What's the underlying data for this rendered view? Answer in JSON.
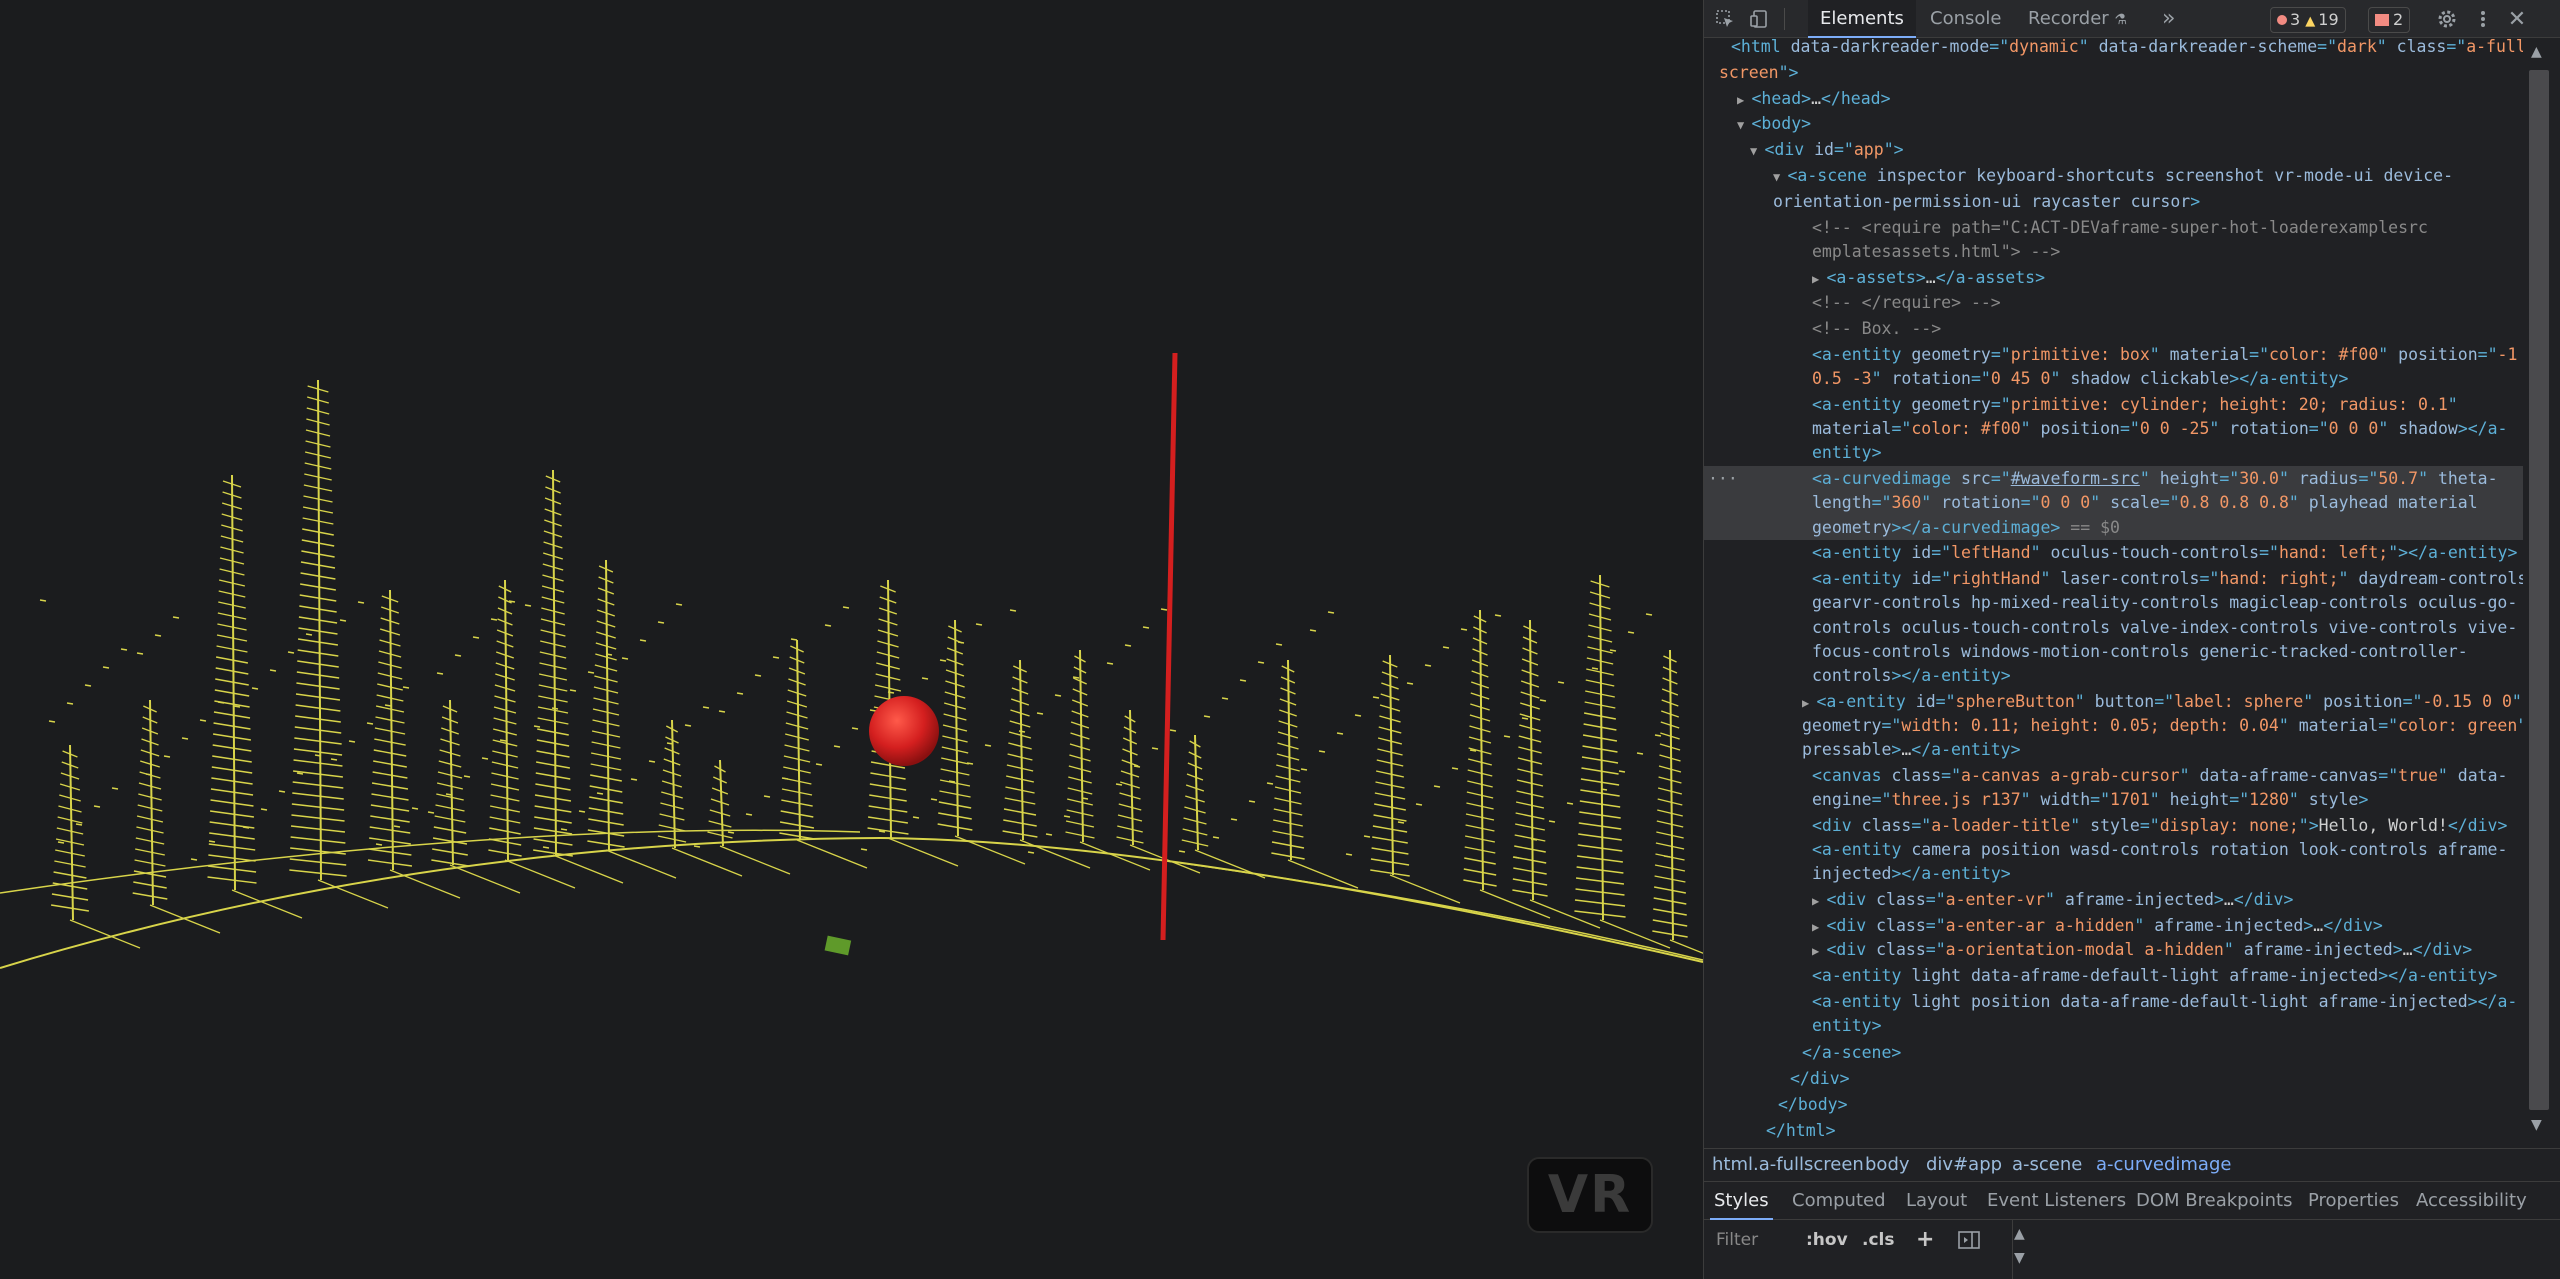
{
  "devtools": {
    "tabs": {
      "elements": "Elements",
      "console": "Console",
      "recorder": "Recorder",
      "more": "»"
    },
    "counters": {
      "errors": "3",
      "warnings": "19",
      "issues": "2"
    },
    "tree": [
      {
        "parts": [
          [
            "tag",
            "<html "
          ],
          [
            "an",
            "data-darkreader-mode"
          ],
          [
            "tag",
            "=\""
          ],
          [
            "av",
            "dynamic"
          ],
          [
            "tag",
            "\" "
          ],
          [
            "an",
            "data-darkreader-scheme"
          ],
          [
            "tag",
            "=\""
          ],
          [
            "av",
            "dark"
          ],
          [
            "tag",
            "\" "
          ],
          [
            "an",
            "class"
          ],
          [
            "tag",
            "=\""
          ],
          [
            "av",
            "a-full"
          ]
        ]
      },
      {
        "parts": [
          [
            "av",
            "screen"
          ],
          [
            "tag",
            "\">"
          ]
        ]
      },
      {
        "parts": [
          [
            "tag",
            "<head>"
          ],
          [
            "tx",
            "…"
          ],
          [
            "tag",
            "</head>"
          ]
        ]
      },
      {
        "parts": [
          [
            "tag",
            "<body>"
          ]
        ]
      },
      {
        "parts": [
          [
            "tag",
            "<div "
          ],
          [
            "an",
            "id"
          ],
          [
            "tag",
            "=\""
          ],
          [
            "av",
            "app"
          ],
          [
            "tag",
            "\">"
          ]
        ]
      },
      {
        "parts": [
          [
            "tag",
            "<a-scene "
          ],
          [
            "an",
            "inspector keyboard-shortcuts screenshot vr-mode-ui device-"
          ]
        ]
      },
      {
        "parts": [
          [
            "an",
            "orientation-permission-ui raycaster cursor"
          ],
          [
            "tag",
            ">"
          ]
        ]
      },
      {
        "parts": [
          [
            "cm",
            "<!-- <require path=\"C:ACT-DEVaframe-super-hot-loaderexamplesrc"
          ]
        ]
      },
      {
        "parts": [
          [
            "cm",
            "emplatesassets.html\"> -->"
          ]
        ]
      },
      {
        "parts": [
          [
            "tag",
            "<a-assets>"
          ],
          [
            "tx",
            "…"
          ],
          [
            "tag",
            "</a-assets>"
          ]
        ]
      },
      {
        "parts": [
          [
            "cm",
            "<!-- </require> -->"
          ]
        ]
      },
      {
        "parts": [
          [
            "cm",
            "<!-- Box. -->"
          ]
        ]
      },
      {
        "parts": [
          [
            "tag",
            "<a-entity "
          ],
          [
            "an",
            "geometry"
          ],
          [
            "tag",
            "=\""
          ],
          [
            "av",
            "primitive: box"
          ],
          [
            "tag",
            "\" "
          ],
          [
            "an",
            "material"
          ],
          [
            "tag",
            "=\""
          ],
          [
            "av",
            "color: #f00"
          ],
          [
            "tag",
            "\" "
          ],
          [
            "an",
            "position"
          ],
          [
            "tag",
            "=\""
          ],
          [
            "av",
            "-1"
          ]
        ]
      },
      {
        "parts": [
          [
            "av",
            "0.5 -3"
          ],
          [
            "tag",
            "\" "
          ],
          [
            "an",
            "rotation"
          ],
          [
            "tag",
            "=\""
          ],
          [
            "av",
            "0 45 0"
          ],
          [
            "tag",
            "\" "
          ],
          [
            "an",
            "shadow clickable"
          ],
          [
            "tag",
            "></a-entity>"
          ]
        ]
      },
      {
        "parts": [
          [
            "tag",
            "<a-entity "
          ],
          [
            "an",
            "geometry"
          ],
          [
            "tag",
            "=\""
          ],
          [
            "av",
            "primitive: cylinder; height: 20; radius: 0.1"
          ],
          [
            "tag",
            "\""
          ]
        ]
      },
      {
        "parts": [
          [
            "an",
            "material"
          ],
          [
            "tag",
            "=\""
          ],
          [
            "av",
            "color: #f00"
          ],
          [
            "tag",
            "\" "
          ],
          [
            "an",
            "position"
          ],
          [
            "tag",
            "=\""
          ],
          [
            "av",
            "0 0 -25"
          ],
          [
            "tag",
            "\" "
          ],
          [
            "an",
            "rotation"
          ],
          [
            "tag",
            "=\""
          ],
          [
            "av",
            "0 0 0"
          ],
          [
            "tag",
            "\" "
          ],
          [
            "an",
            "shadow"
          ],
          [
            "tag",
            "></a-"
          ]
        ]
      },
      {
        "parts": [
          [
            "tag",
            "entity>"
          ]
        ]
      },
      {
        "parts": [
          [
            "tag",
            "<a-curvedimage "
          ],
          [
            "an",
            "src"
          ],
          [
            "tag",
            "=\""
          ],
          [
            "link",
            "#waveform-src"
          ],
          [
            "tag",
            "\" "
          ],
          [
            "an",
            "height"
          ],
          [
            "tag",
            "=\""
          ],
          [
            "av",
            "30.0"
          ],
          [
            "tag",
            "\" "
          ],
          [
            "an",
            "radius"
          ],
          [
            "tag",
            "=\""
          ],
          [
            "av",
            "50.7"
          ],
          [
            "tag",
            "\" "
          ],
          [
            "an",
            "theta-"
          ]
        ]
      },
      {
        "parts": [
          [
            "an",
            "length"
          ],
          [
            "tag",
            "=\""
          ],
          [
            "av",
            "360"
          ],
          [
            "tag",
            "\" "
          ],
          [
            "an",
            "rotation"
          ],
          [
            "tag",
            "=\""
          ],
          [
            "av",
            "0 0 0"
          ],
          [
            "tag",
            "\" "
          ],
          [
            "an",
            "scale"
          ],
          [
            "tag",
            "=\""
          ],
          [
            "av",
            "0.8 0.8 0.8"
          ],
          [
            "tag",
            "\" "
          ],
          [
            "an",
            "playhead material"
          ]
        ]
      },
      {
        "parts": [
          [
            "an",
            "geometry"
          ],
          [
            "tag",
            "></a-curvedimage>"
          ],
          [
            "cm",
            " == $0"
          ]
        ]
      },
      {
        "parts": [
          [
            "tag",
            "<a-entity "
          ],
          [
            "an",
            "id"
          ],
          [
            "tag",
            "=\""
          ],
          [
            "av",
            "leftHand"
          ],
          [
            "tag",
            "\" "
          ],
          [
            "an",
            "oculus-touch-controls"
          ],
          [
            "tag",
            "=\""
          ],
          [
            "av",
            "hand: left;"
          ],
          [
            "tag",
            "\"></a-entity>"
          ]
        ]
      },
      {
        "parts": [
          [
            "tag",
            "<a-entity "
          ],
          [
            "an",
            "id"
          ],
          [
            "tag",
            "=\""
          ],
          [
            "av",
            "rightHand"
          ],
          [
            "tag",
            "\" "
          ],
          [
            "an",
            "laser-controls"
          ],
          [
            "tag",
            "=\""
          ],
          [
            "av",
            "hand: right;"
          ],
          [
            "tag",
            "\" "
          ],
          [
            "an",
            "daydream-controls"
          ]
        ]
      },
      {
        "parts": [
          [
            "an",
            "gearvr-controls hp-mixed-reality-controls magicleap-controls oculus-go-"
          ]
        ]
      },
      {
        "parts": [
          [
            "an",
            "controls oculus-touch-controls valve-index-controls vive-controls vive-"
          ]
        ]
      },
      {
        "parts": [
          [
            "an",
            "focus-controls windows-motion-controls generic-tracked-controller-"
          ]
        ]
      },
      {
        "parts": [
          [
            "an",
            "controls"
          ],
          [
            "tag",
            "></a-entity>"
          ]
        ]
      },
      {
        "parts": [
          [
            "tag",
            "<a-entity "
          ],
          [
            "an",
            "id"
          ],
          [
            "tag",
            "=\""
          ],
          [
            "av",
            "sphereButton"
          ],
          [
            "tag",
            "\" "
          ],
          [
            "an",
            "button"
          ],
          [
            "tag",
            "=\""
          ],
          [
            "av",
            "label: sphere"
          ],
          [
            "tag",
            "\" "
          ],
          [
            "an",
            "position"
          ],
          [
            "tag",
            "=\""
          ],
          [
            "av",
            "-0.15 0 0"
          ],
          [
            "tag",
            "\""
          ]
        ]
      },
      {
        "parts": [
          [
            "an",
            "geometry"
          ],
          [
            "tag",
            "=\""
          ],
          [
            "av",
            "width: 0.11; height: 0.05; depth: 0.04"
          ],
          [
            "tag",
            "\" "
          ],
          [
            "an",
            "material"
          ],
          [
            "tag",
            "=\""
          ],
          [
            "av",
            "color: green"
          ],
          [
            "tag",
            "\""
          ]
        ]
      },
      {
        "parts": [
          [
            "an",
            "pressable"
          ],
          [
            "tag",
            ">"
          ],
          [
            "tx",
            "…"
          ],
          [
            "tag",
            "</a-entity>"
          ]
        ]
      },
      {
        "parts": [
          [
            "tag",
            "<canvas "
          ],
          [
            "an",
            "class"
          ],
          [
            "tag",
            "=\""
          ],
          [
            "av",
            "a-canvas a-grab-cursor"
          ],
          [
            "tag",
            "\" "
          ],
          [
            "an",
            "data-aframe-canvas"
          ],
          [
            "tag",
            "=\""
          ],
          [
            "av",
            "true"
          ],
          [
            "tag",
            "\" "
          ],
          [
            "an",
            "data-"
          ]
        ]
      },
      {
        "parts": [
          [
            "an",
            "engine"
          ],
          [
            "tag",
            "=\""
          ],
          [
            "av",
            "three.js r137"
          ],
          [
            "tag",
            "\" "
          ],
          [
            "an",
            "width"
          ],
          [
            "tag",
            "=\""
          ],
          [
            "av",
            "1701"
          ],
          [
            "tag",
            "\" "
          ],
          [
            "an",
            "height"
          ],
          [
            "tag",
            "=\""
          ],
          [
            "av",
            "1280"
          ],
          [
            "tag",
            "\" "
          ],
          [
            "an",
            "style"
          ],
          [
            "tag",
            ">"
          ]
        ]
      },
      {
        "parts": [
          [
            "tag",
            "<div "
          ],
          [
            "an",
            "class"
          ],
          [
            "tag",
            "=\""
          ],
          [
            "av",
            "a-loader-title"
          ],
          [
            "tag",
            "\" "
          ],
          [
            "an",
            "style"
          ],
          [
            "tag",
            "=\""
          ],
          [
            "av",
            "display: none;"
          ],
          [
            "tag",
            "\">"
          ],
          [
            "tx",
            "Hello, World!"
          ],
          [
            "tag",
            "</div>"
          ]
        ]
      },
      {
        "parts": [
          [
            "tag",
            "<a-entity "
          ],
          [
            "an",
            "camera position wasd-controls rotation look-controls aframe-"
          ]
        ]
      },
      {
        "parts": [
          [
            "an",
            "injected"
          ],
          [
            "tag",
            "></a-entity>"
          ]
        ]
      },
      {
        "parts": [
          [
            "tag",
            "<div "
          ],
          [
            "an",
            "class"
          ],
          [
            "tag",
            "=\""
          ],
          [
            "av",
            "a-enter-vr"
          ],
          [
            "tag",
            "\" "
          ],
          [
            "an",
            "aframe-injected"
          ],
          [
            "tag",
            ">"
          ],
          [
            "tx",
            "…"
          ],
          [
            "tag",
            "</div>"
          ]
        ]
      },
      {
        "parts": [
          [
            "tag",
            "<div "
          ],
          [
            "an",
            "class"
          ],
          [
            "tag",
            "=\""
          ],
          [
            "av",
            "a-enter-ar a-hidden"
          ],
          [
            "tag",
            "\" "
          ],
          [
            "an",
            "aframe-injected"
          ],
          [
            "tag",
            ">"
          ],
          [
            "tx",
            "…"
          ],
          [
            "tag",
            "</div>"
          ]
        ]
      },
      {
        "parts": [
          [
            "tag",
            "<div "
          ],
          [
            "an",
            "class"
          ],
          [
            "tag",
            "=\""
          ],
          [
            "av",
            "a-orientation-modal a-hidden"
          ],
          [
            "tag",
            "\" "
          ],
          [
            "an",
            "aframe-injected"
          ],
          [
            "tag",
            ">"
          ],
          [
            "tx",
            "…"
          ],
          [
            "tag",
            "</div>"
          ]
        ]
      },
      {
        "parts": [
          [
            "tag",
            "<a-entity "
          ],
          [
            "an",
            "light data-aframe-default-light aframe-injected"
          ],
          [
            "tag",
            "></a-entity>"
          ]
        ]
      },
      {
        "parts": [
          [
            "tag",
            "<a-entity "
          ],
          [
            "an",
            "light position data-aframe-default-light aframe-injected"
          ],
          [
            "tag",
            "></a-"
          ]
        ]
      },
      {
        "parts": [
          [
            "tag",
            "entity>"
          ]
        ]
      },
      {
        "parts": [
          [
            "tag",
            "</a-scene>"
          ]
        ]
      },
      {
        "parts": [
          [
            "tag",
            "</div>"
          ]
        ]
      },
      {
        "parts": [
          [
            "tag",
            "</body>"
          ]
        ]
      },
      {
        "parts": [
          [
            "tag",
            "</html>"
          ]
        ]
      }
    ],
    "breadcrumbs": [
      "html.a-fullscreen",
      "body",
      "div#app",
      "a-scene",
      "a-curvedimage"
    ],
    "subtabs": [
      "Styles",
      "Computed",
      "Layout",
      "Event Listeners",
      "DOM Breakpoints",
      "Properties",
      "Accessibility"
    ],
    "filter_placeholder": "Filter",
    "filter_buttons": {
      "hov": ":hov",
      "cls": ".cls",
      "add": "+"
    }
  },
  "scene": {
    "vr_button_label": "VR",
    "colors": {
      "waveform": "#d8d44a",
      "playhead": "#d41f1f",
      "sphere": "#d41f1f",
      "box": "#5f9a2a",
      "background": "#1b1c1e"
    }
  }
}
